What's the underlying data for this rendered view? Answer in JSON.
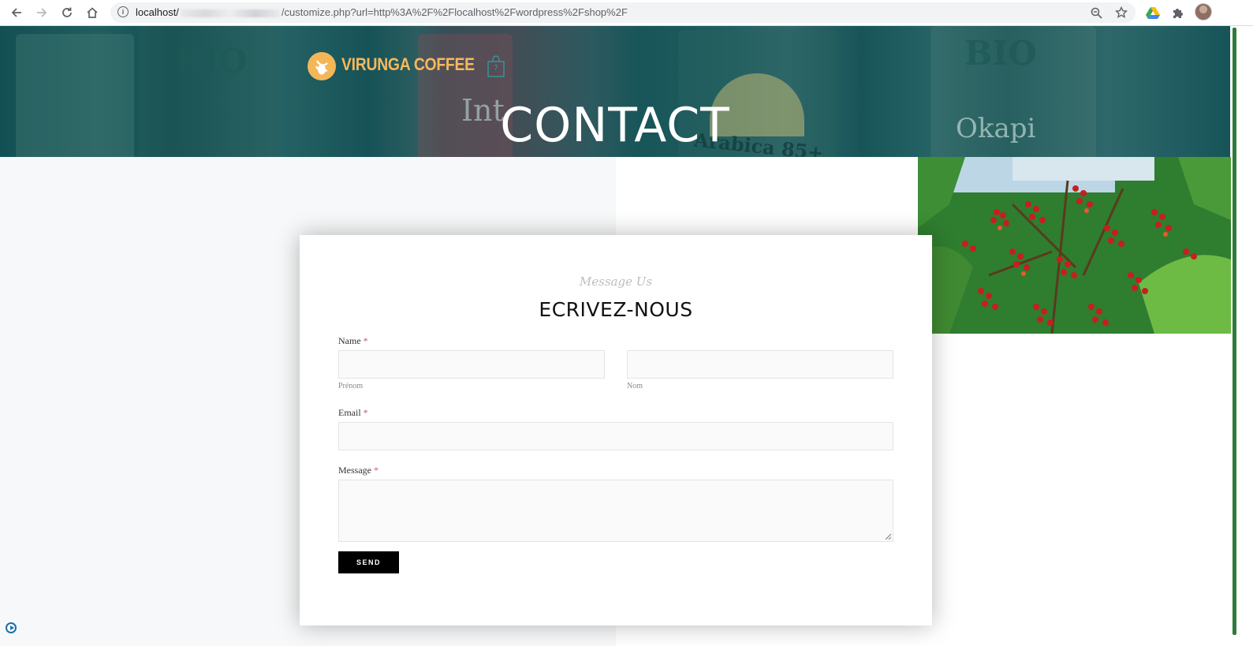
{
  "browser": {
    "url_host": "localhost/",
    "url_path": "/customize.php?url=http%3A%2F%2Flocalhost%2Fwordpress%2Fshop%2F",
    "back_icon": "arrow-left-icon",
    "forward_icon": "arrow-right-icon",
    "reload_icon": "reload-icon",
    "home_icon": "home-icon",
    "info_icon": "info-icon",
    "zoom_icon": "zoom-icon",
    "bookmark_icon": "star-icon",
    "drive_icon": "google-drive-icon",
    "extensions_icon": "puzzle-icon"
  },
  "header": {
    "brand": "VIRUNGA COFFEE",
    "cart_count": "7",
    "page_title": "CONTACT",
    "hero_bag_labels": [
      "BIO",
      "Int",
      "Arabica 85+",
      "BIO",
      "Okapi"
    ]
  },
  "form": {
    "subtitle": "Message Us",
    "title": "ECRIVEZ-NOUS",
    "name_label": "Name",
    "required_mark": "*",
    "first_name_sublabel": "Prénom",
    "last_name_sublabel": "Nom",
    "email_label": "Email",
    "message_label": "Message",
    "send_label": "SEND"
  },
  "colors": {
    "brand": "#f5b95c",
    "hero_overlay": "#065058",
    "required": "#d9534f",
    "button": "#000000"
  }
}
